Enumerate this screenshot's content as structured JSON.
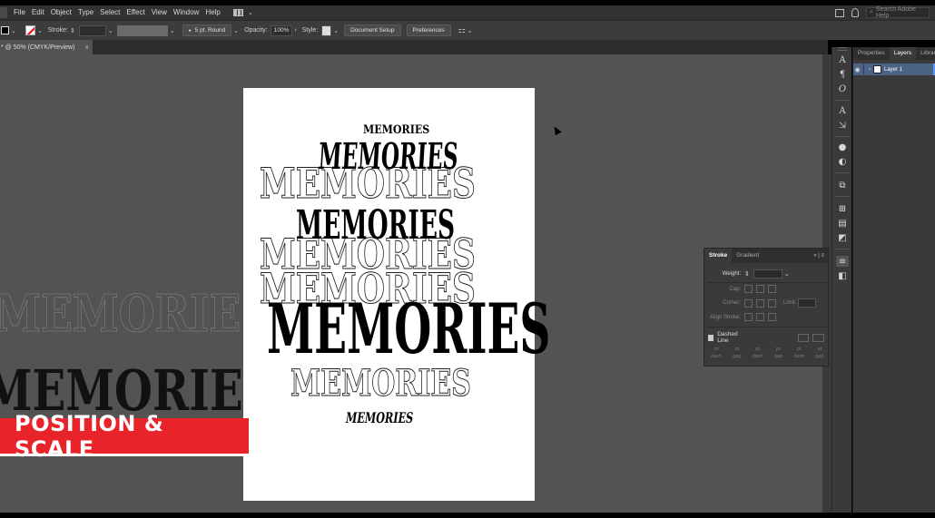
{
  "menubar": {
    "items": [
      "File",
      "Edit",
      "Object",
      "Type",
      "Select",
      "Effect",
      "View",
      "Window",
      "Help"
    ],
    "search_placeholder": "Search Adobe Help"
  },
  "control": {
    "stroke_label": "Stroke:",
    "brush_label": "5 pt. Round",
    "opacity_label": "Opacity:",
    "opacity_value": "100%",
    "style_label": "Style:",
    "doc_setup_label": "Document Setup",
    "preferences_label": "Preferences"
  },
  "document": {
    "tab_title": "* @ 50% (CMYK/Preview)",
    "close_glyph": "×"
  },
  "artwork": {
    "text": "MEMORIES"
  },
  "banner": {
    "text": "POSITION & SCALE",
    "color": "#e8242a"
  },
  "tools": [
    "A",
    "¶",
    "O",
    "A",
    "⇲",
    "●",
    "◐",
    "⧉",
    "⊞",
    "▤",
    "◩",
    "≡",
    "◧"
  ],
  "panel": {
    "tabs": [
      "Properties",
      "Layers",
      "Librar"
    ],
    "active_tab": "Layers",
    "layer_name": "Layer 1",
    "layer_color": "#4b6486"
  },
  "stroke_panel": {
    "tabs": [
      "Stroke",
      "Gradient"
    ],
    "weight_label": "Weight:",
    "cap_label": "Cap:",
    "corner_label": "Corner:",
    "limit_label": "Limit:",
    "align_label": "Align Stroke:",
    "dashed_label": "Dashed Line",
    "dash_fields": [
      {
        "top": "pt",
        "bottom": "dash"
      },
      {
        "top": "pt",
        "bottom": "gap"
      },
      {
        "top": "pt",
        "bottom": "dash"
      },
      {
        "top": "pt",
        "bottom": "gap"
      },
      {
        "top": "pt",
        "bottom": "dash"
      },
      {
        "top": "pt",
        "bottom": "gap"
      }
    ]
  }
}
